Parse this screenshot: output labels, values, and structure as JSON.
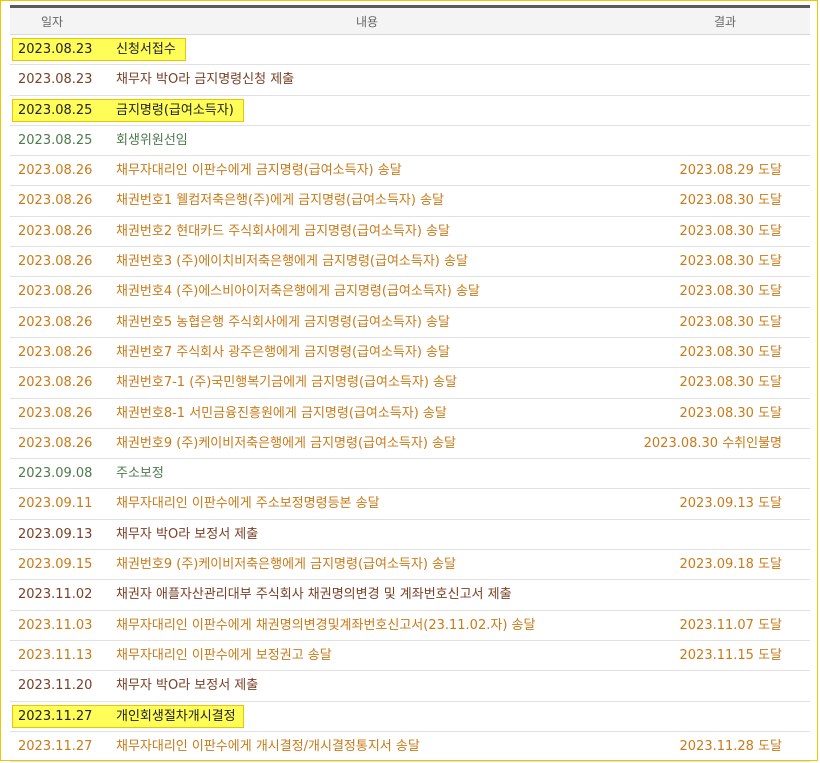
{
  "header": {
    "date": "일자",
    "content": "내용",
    "result": "결과"
  },
  "colors": {
    "orange": "#c97a18",
    "green": "#4e7a4e",
    "brown": "#7a4026",
    "highlight": "#fffd57",
    "highlight_border": "#f2c200"
  },
  "rows": [
    {
      "date": "2023.08.23",
      "content": "신청서접수",
      "result": "",
      "tone": "black",
      "highlighted": true
    },
    {
      "date": "2023.08.23",
      "content": "채무자 박O라 금지명령신청 제출",
      "result": "",
      "tone": "brown",
      "highlighted": false
    },
    {
      "date": "2023.08.25",
      "content": "금지명령(급여소득자)",
      "result": "",
      "tone": "green",
      "highlighted": true
    },
    {
      "date": "2023.08.25",
      "content": "회생위원선임",
      "result": "",
      "tone": "green",
      "highlighted": false
    },
    {
      "date": "2023.08.26",
      "content": "채무자대리인 이판수에게 금지명령(급여소득자) 송달",
      "result": "2023.08.29 도달",
      "tone": "orange",
      "highlighted": false
    },
    {
      "date": "2023.08.26",
      "content": "채권번호1 웰컴저축은행(주)에게 금지명령(급여소득자) 송달",
      "result": "2023.08.30 도달",
      "tone": "orange",
      "highlighted": false
    },
    {
      "date": "2023.08.26",
      "content": "채권번호2 현대카드 주식회사에게 금지명령(급여소득자) 송달",
      "result": "2023.08.30 도달",
      "tone": "orange",
      "highlighted": false
    },
    {
      "date": "2023.08.26",
      "content": "채권번호3 (주)에이치비저축은행에게 금지명령(급여소득자) 송달",
      "result": "2023.08.30 도달",
      "tone": "orange",
      "highlighted": false
    },
    {
      "date": "2023.08.26",
      "content": "채권번호4 (주)에스비아이저축은행에게 금지명령(급여소득자) 송달",
      "result": "2023.08.30 도달",
      "tone": "orange",
      "highlighted": false
    },
    {
      "date": "2023.08.26",
      "content": "채권번호5 농협은행 주식회사에게 금지명령(급여소득자) 송달",
      "result": "2023.08.30 도달",
      "tone": "orange",
      "highlighted": false
    },
    {
      "date": "2023.08.26",
      "content": "채권번호7 주식회사 광주은행에게 금지명령(급여소득자) 송달",
      "result": "2023.08.30 도달",
      "tone": "orange",
      "highlighted": false
    },
    {
      "date": "2023.08.26",
      "content": "채권번호7-1 (주)국민행복기금에게 금지명령(급여소득자) 송달",
      "result": "2023.08.30 도달",
      "tone": "orange",
      "highlighted": false
    },
    {
      "date": "2023.08.26",
      "content": "채권번호8-1 서민금융진흥원에게 금지명령(급여소득자) 송달",
      "result": "2023.08.30 도달",
      "tone": "orange",
      "highlighted": false
    },
    {
      "date": "2023.08.26",
      "content": "채권번호9 (주)케이비저축은행에게 금지명령(급여소득자) 송달",
      "result": "2023.08.30 수취인불명",
      "tone": "orange",
      "highlighted": false
    },
    {
      "date": "2023.09.08",
      "content": "주소보정",
      "result": "",
      "tone": "green",
      "highlighted": false
    },
    {
      "date": "2023.09.11",
      "content": "채무자대리인 이판수에게 주소보정명령등본 송달",
      "result": "2023.09.13 도달",
      "tone": "orange",
      "highlighted": false
    },
    {
      "date": "2023.09.13",
      "content": "채무자 박O라 보정서 제출",
      "result": "",
      "tone": "brown",
      "highlighted": false
    },
    {
      "date": "2023.09.15",
      "content": "채권번호9 (주)케이비저축은행에게 금지명령(급여소득자) 송달",
      "result": "2023.09.18 도달",
      "tone": "orange",
      "highlighted": false
    },
    {
      "date": "2023.11.02",
      "content": "채권자 애플자산관리대부 주식회사 채권명의변경 및 계좌번호신고서 제출",
      "result": "",
      "tone": "brown",
      "highlighted": false
    },
    {
      "date": "2023.11.03",
      "content": "채무자대리인 이판수에게 채권명의변경및계좌번호신고서(23.11.02.자) 송달",
      "result": "2023.11.07 도달",
      "tone": "orange",
      "highlighted": false
    },
    {
      "date": "2023.11.13",
      "content": "채무자대리인 이판수에게 보정권고 송달",
      "result": "2023.11.15 도달",
      "tone": "orange",
      "highlighted": false
    },
    {
      "date": "2023.11.20",
      "content": "채무자 박O라 보정서 제출",
      "result": "",
      "tone": "brown",
      "highlighted": false
    },
    {
      "date": "2023.11.27",
      "content": "개인회생절차개시결정",
      "result": "",
      "tone": "green",
      "highlighted": true
    },
    {
      "date": "2023.11.27",
      "content": "채무자대리인 이판수에게 개시결정/개시결정통지서 송달",
      "result": "2023.11.28 도달",
      "tone": "orange",
      "highlighted": false
    }
  ]
}
